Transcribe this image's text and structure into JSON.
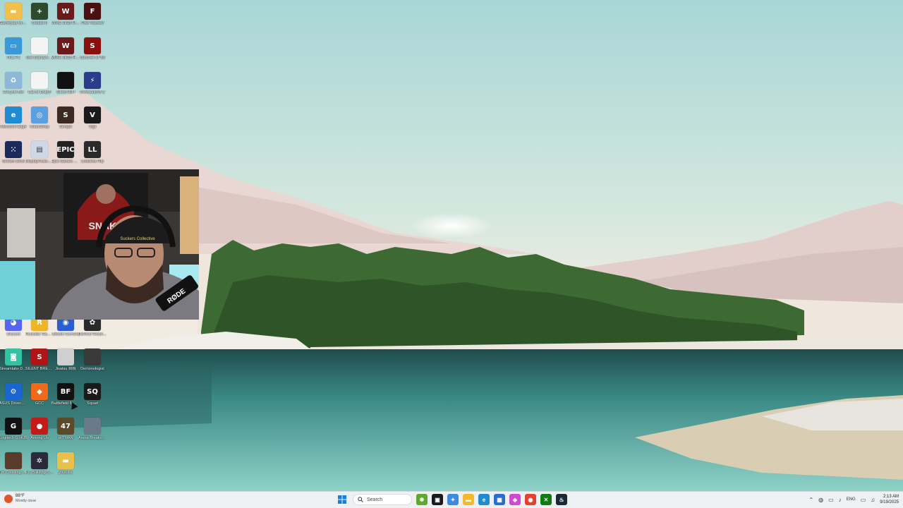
{
  "desktop": {
    "icons": [
      {
        "label": "Gameplay folder",
        "color": "#f2c04a",
        "glyph": "▬",
        "col": 0,
        "row": 0
      },
      {
        "label": "Outlast II",
        "color": "#2d4a2c",
        "glyph": "+",
        "col": 1,
        "row": 0
      },
      {
        "label": "WWE 2K25 Hellish Fea...",
        "color": "#6a1a1a",
        "glyph": "W",
        "col": 2,
        "row": 0
      },
      {
        "label": "Find Yourself",
        "color": "#4a1010",
        "glyph": "F",
        "col": 3,
        "row": 0
      },
      {
        "label": "This PC",
        "color": "#3a98d8",
        "glyph": "▭",
        "col": 0,
        "row": 1
      },
      {
        "label": "Tom Clancy's Rainbow Six...",
        "color": "#f4f4f4",
        "glyph": "",
        "col": 1,
        "row": 1
      },
      {
        "label": "WWE 2K25 Hellish Fea...",
        "color": "#6a1a1a",
        "glyph": "W",
        "col": 2,
        "row": 1
      },
      {
        "label": "Summer of '58",
        "color": "#8a1010",
        "glyph": "S",
        "col": 3,
        "row": 1
      },
      {
        "label": "Recycle Bin",
        "color": "#8fb7d8",
        "glyph": "♻",
        "col": 0,
        "row": 2
      },
      {
        "label": "Call of Duty®",
        "color": "#f4f4f4",
        "glyph": "",
        "col": 1,
        "row": 2
      },
      {
        "label": "Silent Hill f",
        "color": "#111111",
        "glyph": "",
        "col": 2,
        "row": 2
      },
      {
        "label": "Overwatch® 2",
        "color": "#2a3c8a",
        "glyph": "⚡",
        "col": 3,
        "row": 2
      },
      {
        "label": "Microsoft Edge",
        "color": "#1e8bd3",
        "glyph": "e",
        "col": 0,
        "row": 3
      },
      {
        "label": "CleanShop",
        "color": "#5aa0e0",
        "glyph": "◎",
        "col": 1,
        "row": 3
      },
      {
        "label": "Seraph",
        "color": "#3a2a22",
        "glyph": "S",
        "col": 2,
        "row": 3
      },
      {
        "label": "Vigil",
        "color": "#1a1a1a",
        "glyph": "V",
        "col": 3,
        "row": 3
      },
      {
        "label": "Stream Deck",
        "color": "#1b2a5a",
        "glyph": "⁙",
        "col": 0,
        "row": 4
      },
      {
        "label": "DisplayFusion Center",
        "color": "#d0d8e8",
        "glyph": "▤",
        "col": 1,
        "row": 4
      },
      {
        "label": "Epic Games Launcher",
        "color": "#222222",
        "glyph": "EPIC",
        "col": 2,
        "row": 4
      },
      {
        "label": "Lossless Flip",
        "color": "#2a2a2a",
        "glyph": "LL",
        "col": 3,
        "row": 4
      },
      {
        "label": "Discord",
        "color": "#5865f2",
        "glyph": "◕",
        "col": 0,
        "row": 9
      },
      {
        "label": "Rockstar Games...",
        "color": "#f0b428",
        "glyph": "R",
        "col": 1,
        "row": 9
      },
      {
        "label": "Ubisoft Connect",
        "color": "#2a5ed0",
        "glyph": "◉",
        "col": 2,
        "row": 9
      },
      {
        "label": "DaVinci Resolve",
        "color": "#2a2a2a",
        "glyph": "✿",
        "col": 3,
        "row": 9
      },
      {
        "label": "Streamlabs Desktop",
        "color": "#31c3a2",
        "glyph": "◙",
        "col": 0,
        "row": 10
      },
      {
        "label": "SILENT BREATH",
        "color": "#b01515",
        "glyph": "S",
        "col": 1,
        "row": 10
      },
      {
        "label": "Jisatsu 自殺",
        "color": "#cfcfcf",
        "glyph": "",
        "col": 2,
        "row": 10
      },
      {
        "label": "Demonologist",
        "color": "#3a3a3a",
        "glyph": "",
        "col": 3,
        "row": 10
      },
      {
        "label": "ASUS DriverHub",
        "color": "#1a66d0",
        "glyph": "⚙",
        "col": 0,
        "row": 11
      },
      {
        "label": "GCC",
        "color": "#f06a1a",
        "glyph": "◆",
        "col": 1,
        "row": 11
      },
      {
        "label": "Battlefield 6 Open Beta",
        "color": "#111111",
        "glyph": "BF",
        "col": 2,
        "row": 11
      },
      {
        "label": "Squad",
        "color": "#1a1a1a",
        "glyph": "SQ",
        "col": 3,
        "row": 11
      },
      {
        "label": "Logitech G HUB",
        "color": "#111111",
        "glyph": "G",
        "col": 0,
        "row": 12
      },
      {
        "label": "Among Us",
        "color": "#c41a1a",
        "glyph": "●",
        "col": 1,
        "row": 12
      },
      {
        "label": "HITMAN",
        "color": "#5a4a2a",
        "glyph": "47",
        "col": 2,
        "row": 12
      },
      {
        "label": "Arena Breakout...",
        "color": "#6a7a8a",
        "glyph": "",
        "col": 3,
        "row": 12
      },
      {
        "label": "I'm Counting to...",
        "color": "#5a3a2a",
        "glyph": "",
        "col": 0,
        "row": 13
      },
      {
        "label": "PC Building Simulator",
        "color": "#2a2a3a",
        "glyph": "✲",
        "col": 1,
        "row": 13
      },
      {
        "label": "youtube",
        "color": "#e8c04a",
        "glyph": "▬",
        "col": 2,
        "row": 13
      }
    ]
  },
  "webcam": {
    "cap_text": "Suckers Collective",
    "mic_text": "RØDE",
    "poster_text": "SNAKE"
  },
  "taskbar": {
    "weather": {
      "temp": "88°F",
      "condition": "Mostly clear"
    },
    "search_placeholder": "Search",
    "apps": [
      {
        "name": "widgets",
        "color": "#5fa82f",
        "glyph": "❋"
      },
      {
        "name": "task-view",
        "color": "#1a1a1a",
        "glyph": "▣"
      },
      {
        "name": "copilot",
        "color": "#3d8ae0",
        "glyph": "✦"
      },
      {
        "name": "file-explorer",
        "color": "#f2b92a",
        "glyph": "▬"
      },
      {
        "name": "edge",
        "color": "#1e8bd3",
        "glyph": "e"
      },
      {
        "name": "store",
        "color": "#2a6ed0",
        "glyph": "▦"
      },
      {
        "name": "app-generic",
        "color": "#d04ad0",
        "glyph": "◈"
      },
      {
        "name": "chrome",
        "color": "#e0432e",
        "glyph": "◉"
      },
      {
        "name": "xbox",
        "color": "#107c10",
        "glyph": "✕"
      },
      {
        "name": "steam",
        "color": "#1b2838",
        "glyph": "♨"
      }
    ],
    "tray": {
      "lang": "ENG",
      "time": "2:13 AM",
      "date": "9/19/2025"
    }
  },
  "colors": {
    "sky": "#bfe0dc",
    "taskbar": "#eef1f3",
    "water": "#2f7a78"
  }
}
